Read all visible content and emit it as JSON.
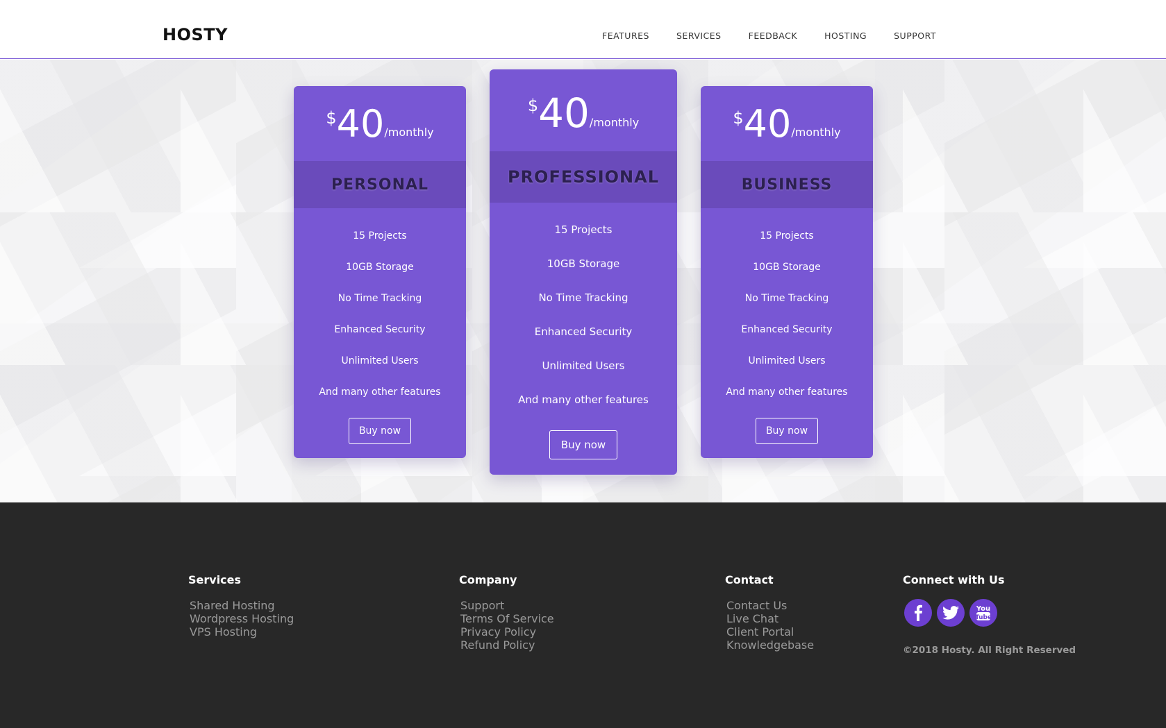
{
  "header": {
    "logo": "HOSTY",
    "nav": [
      "FEATURES",
      "SERVICES",
      "FEEDBACK",
      "HOSTING",
      "SUPPORT"
    ]
  },
  "colors": {
    "accent": "#7857d4",
    "band": "#6a4bbb",
    "footer_bg": "#282828"
  },
  "plans": [
    {
      "currency": "$",
      "amount": "40",
      "period": "/monthly",
      "name": "PERSONAL",
      "features": [
        "15 Projects",
        "10GB Storage",
        "No Time Tracking",
        "Enhanced Security",
        "Unlimited Users",
        "And many other features"
      ],
      "button": "Buy now"
    },
    {
      "currency": "$",
      "amount": "40",
      "period": "/monthly",
      "name": "PROFESSIONAL",
      "features": [
        "15 Projects",
        "10GB Storage",
        "No Time Tracking",
        "Enhanced Security",
        "Unlimited Users",
        "And many other features"
      ],
      "button": "Buy now"
    },
    {
      "currency": "$",
      "amount": "40",
      "period": "/monthly",
      "name": "BUSINESS",
      "features": [
        "15 Projects",
        "10GB Storage",
        "No Time Tracking",
        "Enhanced Security",
        "Unlimited Users",
        "And many other features"
      ],
      "button": "Buy now"
    }
  ],
  "footer": {
    "services": {
      "title": "Services",
      "links": [
        "Shared Hosting",
        "Wordpress Hosting",
        "VPS Hosting"
      ]
    },
    "company": {
      "title": "Company",
      "links": [
        "Support",
        "Terms Of Service",
        "Privacy Policy",
        "Refund Policy"
      ]
    },
    "contact": {
      "title": "Contact",
      "links": [
        "Contact Us",
        "Live Chat",
        "Client Portal",
        "Knowledgebase"
      ]
    },
    "connect": {
      "title": "Connect with Us",
      "icons": [
        "facebook-icon",
        "twitter-icon",
        "youtube-icon"
      ],
      "copyright": "©2018 Hosty. All Right Reserved"
    }
  }
}
